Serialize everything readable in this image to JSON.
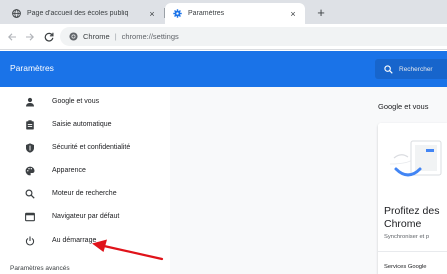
{
  "tabs": [
    {
      "title": "Page d'accueil des écoles publiq",
      "close": "×",
      "icon": "globe-icon",
      "active": false
    },
    {
      "title": "Paramètres",
      "close": "×",
      "icon": "settings-gear-icon",
      "active": true
    }
  ],
  "new_tab_label": "+",
  "toolbar": {
    "chip": "Chrome",
    "divider": "|",
    "url": "chrome://settings"
  },
  "header": {
    "title": "Paramètres",
    "search_placeholder": "Rechercher"
  },
  "sidebar": {
    "items": [
      {
        "label": "Google et vous",
        "icon": "person-icon"
      },
      {
        "label": "Saisie automatique",
        "icon": "clipboard-icon"
      },
      {
        "label": "Sécurité et confidentialité",
        "icon": "shield-icon"
      },
      {
        "label": "Apparence",
        "icon": "palette-icon"
      },
      {
        "label": "Moteur de recherche",
        "icon": "search-icon"
      },
      {
        "label": "Navigateur par défaut",
        "icon": "browser-window-icon"
      },
      {
        "label": "Au démarrage",
        "icon": "power-icon"
      }
    ],
    "advanced_label": "Paramètres avancés"
  },
  "main": {
    "section_title": "Google et vous",
    "card": {
      "heading_line1": "Profitez des",
      "heading_line2": "Chrome",
      "subtitle": "Synchroniser et p",
      "footer": "Services Google"
    }
  },
  "colors": {
    "accent": "#1a73e8",
    "annotation_arrow": "#e0131a"
  }
}
